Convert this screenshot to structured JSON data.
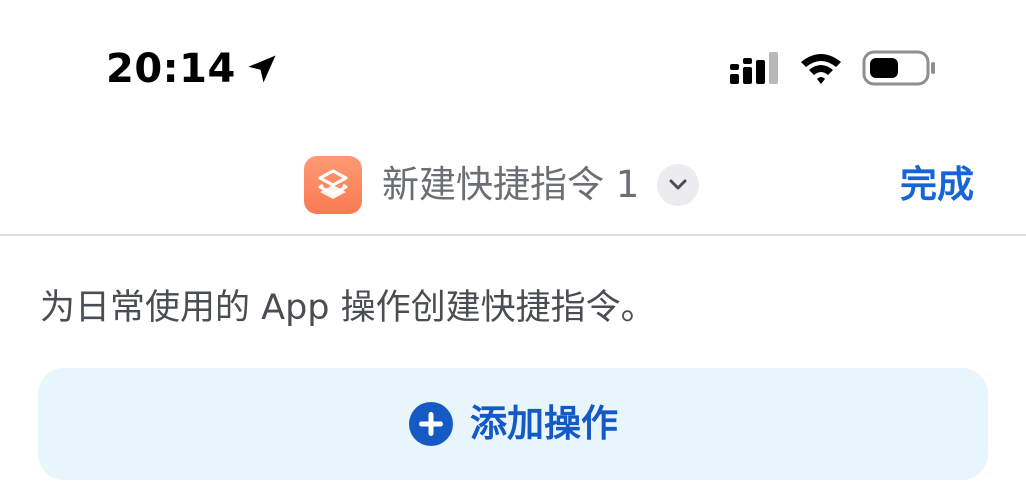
{
  "status_bar": {
    "time": "20:14",
    "icons": [
      "location-arrow-icon",
      "cellular-signal-icon",
      "wifi-icon",
      "battery-icon"
    ]
  },
  "nav": {
    "app_icon": "shortcuts-icon",
    "title": "新建快捷指令 1",
    "chevron_icon": "chevron-down-icon",
    "done_label": "完成"
  },
  "content": {
    "description": "为日常使用的 App 操作创建快捷指令。",
    "add_action": {
      "icon": "plus-circle-icon",
      "label": "添加操作"
    }
  },
  "colors": {
    "accent": "#1565d8",
    "app_icon_bg": "#f97a52",
    "add_action_bg": "#e8f5fd"
  }
}
